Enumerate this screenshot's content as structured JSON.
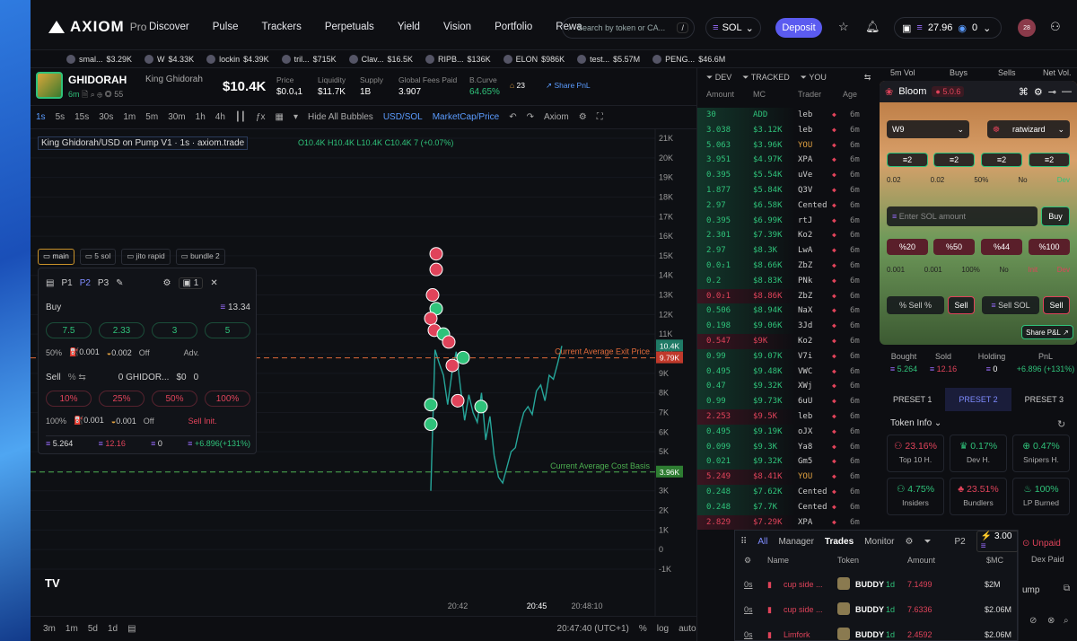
{
  "header": {
    "brand": "AXIOM",
    "brand_suffix": "Pro",
    "nav": [
      "Discover",
      "Pulse",
      "Trackers",
      "Perpetuals",
      "Yield",
      "Vision",
      "Portfolio",
      "Rewa"
    ],
    "search_placeholder": "Search by token or CA...",
    "search_key": "/",
    "chain": "SOL",
    "deposit": "Deposit",
    "balance": "27.96",
    "points": "0",
    "avatar": "28"
  },
  "ticker": [
    {
      "name": "smal...",
      "value": "$3.29K"
    },
    {
      "name": "W",
      "value": "$4.33K"
    },
    {
      "name": "lockin",
      "value": "$4.39K"
    },
    {
      "name": "tril...",
      "value": "$715K"
    },
    {
      "name": "Clav...",
      "value": "$16.5K"
    },
    {
      "name": "RIPB...",
      "value": "$136K"
    },
    {
      "name": "ELON",
      "value": "$986K"
    },
    {
      "name": "test...",
      "value": "$5.57M"
    },
    {
      "name": "PENG...",
      "value": "$46.6M"
    }
  ],
  "token": {
    "symbol": "GHIDORAH",
    "name": "King Ghidorah",
    "age": "6m",
    "holders": "55",
    "price_big": "$10.4K",
    "price_label": "Price",
    "price": "$0.0₄1",
    "liquidity_label": "Liquidity",
    "liquidity": "$11.7K",
    "supply_label": "Supply",
    "supply": "1B",
    "fees_label": "Global Fees Paid",
    "fees": "3.907",
    "bcurve_label": "B.Curve",
    "bcurve": "64.65%",
    "pnl_count": "23",
    "share_pnl": "Share PnL"
  },
  "chart_toolbar": {
    "intervals": [
      "1s",
      "5s",
      "15s",
      "30s",
      "1m",
      "5m",
      "30m",
      "1h",
      "4h"
    ],
    "hide_bubbles": "Hide All Bubbles",
    "usd_sol": "USD/SOL",
    "mcap_price": "MarketCap/Price",
    "axiom": "Axiom"
  },
  "chart_data": {
    "type": "line",
    "title": "King Ghidorah/USD on Pump V1 · 1s · axiom.trade",
    "ohlc": "O10.4K H10.4K L10.4K C10.4K 7 (+0.07%)",
    "y_ticks": [
      "21K",
      "20K",
      "19K",
      "18K",
      "17K",
      "16K",
      "15K",
      "14K",
      "13K",
      "12K",
      "11K",
      "10K",
      "9K",
      "8K",
      "7K",
      "6K",
      "5K",
      "4K",
      "3K",
      "2K",
      "1K",
      "0",
      "-1K"
    ],
    "x_ticks": [
      "20:42",
      "20:45",
      "20:48:10"
    ],
    "ylim": [
      -1000,
      21000
    ],
    "last_price_label": "10.4K",
    "exit_label": "9.79K",
    "cost_label": "3.96K",
    "exit_line_text": "Current Average Exit Price",
    "cost_line_text": "Current Average Cost Basis",
    "exit_value": 9790,
    "cost_value": 3960,
    "series": [
      {
        "values": [
          3000,
          10200,
          9500,
          8900,
          7400,
          9000,
          10100,
          8300,
          6600,
          7900,
          7000,
          6500,
          8000,
          5600,
          6800,
          4800,
          3700,
          3400,
          4200,
          5000,
          5200,
          6200,
          7000,
          7300,
          6900,
          8100,
          8400,
          7600,
          8900,
          8700,
          9500,
          10400
        ]
      }
    ]
  },
  "chart_bottom": {
    "ranges": [
      "3m",
      "1m",
      "5d",
      "1d"
    ],
    "clock": "20:47:40 (UTC+1)",
    "pct": "%",
    "log": "log",
    "auto": "auto"
  },
  "trade_panel": {
    "tabs": [
      "main",
      "5 sol",
      "jito rapid",
      "bundle 2"
    ],
    "presets": [
      "P1",
      "P2",
      "P3"
    ],
    "count": "1",
    "buy_label": "Buy",
    "buy_balance": "13.34",
    "buy_amounts": [
      "7.5",
      "2.33",
      "3",
      "5"
    ],
    "buy_settings": [
      "50%",
      "0.001",
      "0.002",
      "Off",
      "Adv."
    ],
    "sell_label": "Sell",
    "sell_info": "0 GHIDOR...",
    "sell_sol": "$0",
    "sell_zero": "0",
    "sell_amounts": [
      "10%",
      "25%",
      "50%",
      "100%"
    ],
    "sell_settings": [
      "100%",
      "0.001",
      "0.001",
      "Off",
      "Sell Init."
    ],
    "footer": [
      "5.264",
      "12.16",
      "0",
      "+6.896(+131%)"
    ]
  },
  "trades": {
    "tabs": [
      "DEV",
      "TRACKED",
      "YOU"
    ],
    "cols": [
      "Amount",
      "MC",
      "Trader",
      "Age"
    ],
    "rows": [
      {
        "amt": "30",
        "mc": "ADD",
        "tr": "leb",
        "side": "buy"
      },
      {
        "amt": "3.038",
        "mc": "$3.12K",
        "tr": "leb",
        "side": "buy"
      },
      {
        "amt": "5.063",
        "mc": "$3.96K",
        "tr": "YOU",
        "side": "buy"
      },
      {
        "amt": "3.951",
        "mc": "$4.97K",
        "tr": "XPA",
        "side": "buy"
      },
      {
        "amt": "0.395",
        "mc": "$5.54K",
        "tr": "uVe",
        "side": "buy"
      },
      {
        "amt": "1.877",
        "mc": "$5.84K",
        "tr": "Q3V",
        "side": "buy"
      },
      {
        "amt": "2.97",
        "mc": "$6.58K",
        "tr": "Cented",
        "side": "buy"
      },
      {
        "amt": "0.395",
        "mc": "$6.99K",
        "tr": "rtJ",
        "side": "buy"
      },
      {
        "amt": "2.301",
        "mc": "$7.39K",
        "tr": "Ko2",
        "side": "buy"
      },
      {
        "amt": "2.97",
        "mc": "$8.3K",
        "tr": "LwA",
        "side": "buy"
      },
      {
        "amt": "0.0₂1",
        "mc": "$8.66K",
        "tr": "ZbZ",
        "side": "buy"
      },
      {
        "amt": "0.2",
        "mc": "$8.83K",
        "tr": "PNk",
        "side": "buy"
      },
      {
        "amt": "0.0₂1",
        "mc": "$8.86K",
        "tr": "ZbZ",
        "side": "sell"
      },
      {
        "amt": "0.506",
        "mc": "$8.94K",
        "tr": "NaX",
        "side": "buy"
      },
      {
        "amt": "0.198",
        "mc": "$9.06K",
        "tr": "3Jd",
        "side": "buy"
      },
      {
        "amt": "0.547",
        "mc": "$9K",
        "tr": "Ko2",
        "side": "sell"
      },
      {
        "amt": "0.99",
        "mc": "$9.07K",
        "tr": "V7i",
        "side": "buy"
      },
      {
        "amt": "0.495",
        "mc": "$9.48K",
        "tr": "VWC",
        "side": "buy"
      },
      {
        "amt": "0.47",
        "mc": "$9.32K",
        "tr": "XWj",
        "side": "buy"
      },
      {
        "amt": "0.99",
        "mc": "$9.73K",
        "tr": "6uU",
        "side": "buy"
      },
      {
        "amt": "2.253",
        "mc": "$9.5K",
        "tr": "leb",
        "side": "sell"
      },
      {
        "amt": "0.495",
        "mc": "$9.19K",
        "tr": "oJX",
        "side": "buy"
      },
      {
        "amt": "0.099",
        "mc": "$9.3K",
        "tr": "Ya8",
        "side": "buy"
      },
      {
        "amt": "0.021",
        "mc": "$9.32K",
        "tr": "Gm5",
        "side": "buy"
      },
      {
        "amt": "5.249",
        "mc": "$8.41K",
        "tr": "YOU",
        "side": "sell"
      },
      {
        "amt": "0.248",
        "mc": "$7.62K",
        "tr": "Cented",
        "side": "buy"
      },
      {
        "amt": "0.248",
        "mc": "$7.7K",
        "tr": "Cented",
        "side": "buy"
      },
      {
        "amt": "2.829",
        "mc": "$7.29K",
        "tr": "XPA",
        "side": "sell"
      }
    ],
    "age": "6m"
  },
  "bloom": {
    "title": "Bloom",
    "version": "5.0.6",
    "wallet": "W9",
    "account": "ratwizard",
    "presets": [
      "2",
      "2",
      "2",
      "2"
    ],
    "settings": [
      "0.02",
      "0.02",
      "50%",
      "No",
      "Dev"
    ],
    "enter_placeholder": "Enter SOL amount",
    "buy": "Buy",
    "sell_pcts": [
      "20",
      "50",
      "44",
      "100"
    ],
    "sell_settings": [
      "0.001",
      "0.001",
      "100%",
      "No",
      "Init",
      "Dev"
    ],
    "sell_pct_label": "Sell %",
    "sell": "Sell",
    "sell_sol": "Sell SOL",
    "share": "Share P&L"
  },
  "summary": {
    "cols": [
      "5m Vol",
      "Buys",
      "Sells",
      "Net Vol."
    ],
    "bought_label": "Bought",
    "bought": "5.264",
    "sold_label": "Sold",
    "sold": "12.16",
    "holding_label": "Holding",
    "holding": "0",
    "pnl_label": "PnL",
    "pnl": "+6.896 (+131%)",
    "presets": [
      "PRESET 1",
      "PRESET 2",
      "PRESET 3"
    ],
    "token_info": "Token Info",
    "tiles": [
      {
        "v": "23.16%",
        "l": "Top 10 H.",
        "c": "#e0435a"
      },
      {
        "v": "0.17%",
        "l": "Dev H.",
        "c": "#2fc27a"
      },
      {
        "v": "0.47%",
        "l": "Snipers H.",
        "c": "#2fc27a"
      },
      {
        "v": "4.75%",
        "l": "Insiders",
        "c": "#2fc27a"
      },
      {
        "v": "23.51%",
        "l": "Bundlers",
        "c": "#e0435a"
      },
      {
        "v": "100%",
        "l": "LP Burned",
        "c": "#2fc27a"
      }
    ]
  },
  "monitor": {
    "tabs": [
      "All",
      "Manager",
      "Trades",
      "Monitor"
    ],
    "preset": "P2",
    "amount": "3.00",
    "cols": [
      "Name",
      "Token",
      "Amount",
      "$MC"
    ],
    "rows": [
      {
        "age": "0s",
        "name": "cup side ...",
        "token": "BUDDY",
        "tage": "1d",
        "amt": "7.1499",
        "mc": "$2M"
      },
      {
        "age": "0s",
        "name": "cup side ...",
        "token": "BUDDY",
        "tage": "1d",
        "amt": "7.6336",
        "mc": "$2.06M"
      },
      {
        "age": "0s",
        "name": "Limfork",
        "token": "BUDDY",
        "tage": "1d",
        "amt": "2.4592",
        "mc": "$2.06M"
      }
    ],
    "unpaid": "Unpaid",
    "dex_paid": "Dex Paid",
    "pump": "ump"
  }
}
